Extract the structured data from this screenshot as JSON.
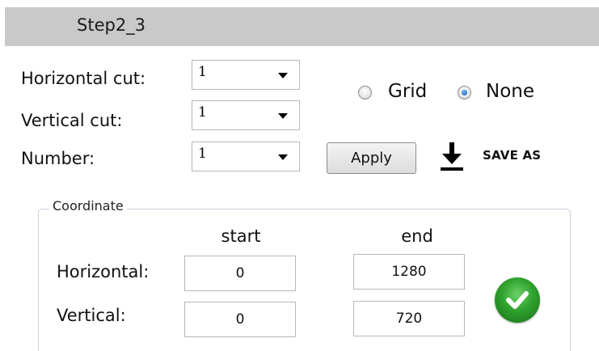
{
  "header": {
    "title": "Step2_3"
  },
  "controls": {
    "horizontal_cut": {
      "label": "Horizontal cut:",
      "value": "1"
    },
    "vertical_cut": {
      "label": "Vertical cut:",
      "value": "1"
    },
    "number": {
      "label": "Number:",
      "value": "1"
    }
  },
  "mode": {
    "options": [
      {
        "label": "Grid",
        "selected": false
      },
      {
        "label": "None",
        "selected": true
      }
    ]
  },
  "actions": {
    "apply_label": "Apply",
    "save_as_label": "SAVE AS",
    "save_icon": "download-icon"
  },
  "coordinate": {
    "legend": "Coordinate",
    "start_header": "start",
    "end_header": "end",
    "horizontal": {
      "label": "Horizontal:",
      "start": "0",
      "end": "1280"
    },
    "vertical": {
      "label": "Vertical:",
      "start": "0",
      "end": "720"
    },
    "confirm_icon": "checkmark-icon"
  },
  "colors": {
    "header_bg": "#c9c9c9",
    "confirm_green": "#2ea12c",
    "radio_selected": "#2e6fd0"
  }
}
